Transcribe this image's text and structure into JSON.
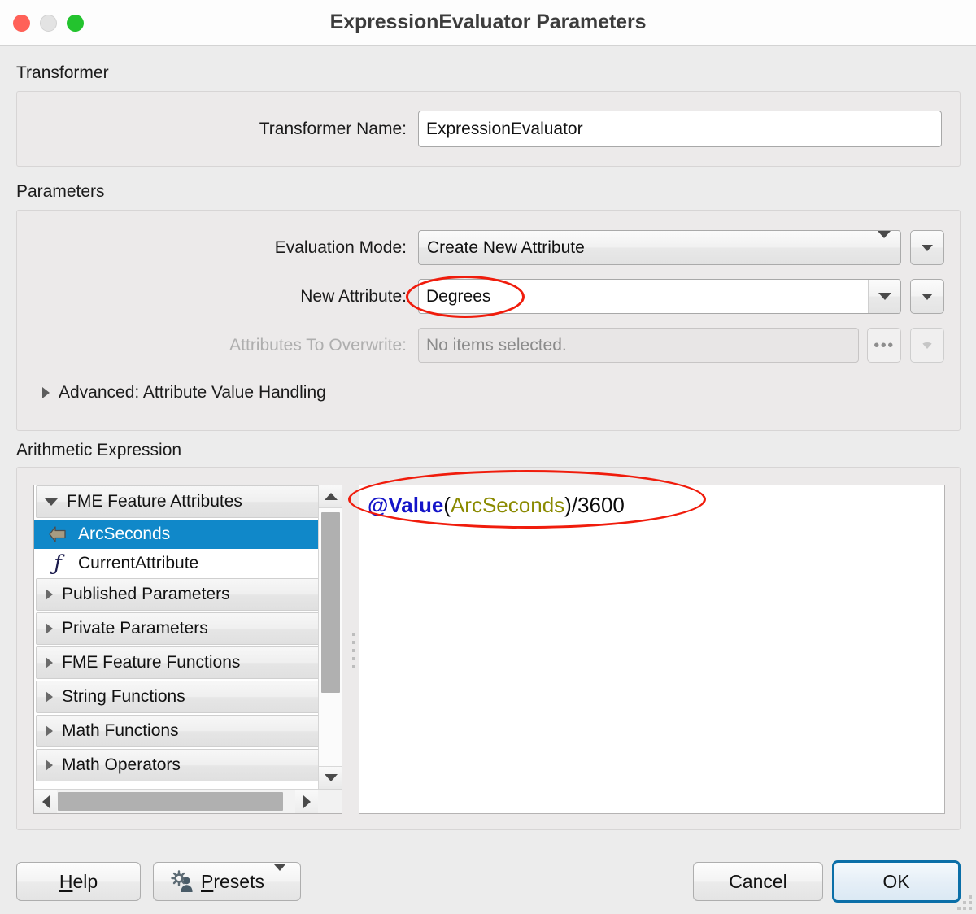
{
  "window": {
    "title": "ExpressionEvaluator Parameters",
    "traffic_lights": [
      "close-button",
      "minimize-button",
      "zoom-button"
    ]
  },
  "transformer_section": {
    "label": "Transformer",
    "name_label": "Transformer Name:",
    "name_value": "ExpressionEvaluator"
  },
  "parameters_section": {
    "label": "Parameters",
    "evaluation_mode": {
      "label": "Evaluation Mode:",
      "value": "Create New Attribute"
    },
    "new_attribute": {
      "label": "New Attribute:",
      "value": "Degrees"
    },
    "attributes_to_overwrite": {
      "label": "Attributes To Overwrite:",
      "value": "No items selected.",
      "browse_label": "...",
      "disabled": true
    },
    "advanced": {
      "label": "Advanced: Attribute Value Handling",
      "expanded": false
    }
  },
  "expression_section": {
    "label": "Arithmetic Expression",
    "tree": [
      {
        "label": "FME Feature Attributes",
        "type": "group",
        "expanded": true,
        "icon": "chevron-down-icon"
      },
      {
        "label": "ArcSeconds",
        "type": "leaf",
        "selected": true,
        "icon": "attribute-arrow-icon"
      },
      {
        "label": "CurrentAttribute",
        "type": "leaf",
        "selected": false,
        "icon": "function-fx-icon"
      },
      {
        "label": "Published Parameters",
        "type": "group",
        "expanded": false,
        "icon": "chevron-right-icon"
      },
      {
        "label": "Private Parameters",
        "type": "group",
        "expanded": false,
        "icon": "chevron-right-icon"
      },
      {
        "label": "FME Feature Functions",
        "type": "group",
        "expanded": false,
        "icon": "chevron-right-icon"
      },
      {
        "label": "String Functions",
        "type": "group",
        "expanded": false,
        "icon": "chevron-right-icon"
      },
      {
        "label": "Math Functions",
        "type": "group",
        "expanded": false,
        "icon": "chevron-right-icon"
      },
      {
        "label": "Math Operators",
        "type": "group",
        "expanded": false,
        "icon": "chevron-right-icon"
      }
    ],
    "editor": {
      "full_text": "@Value(ArcSeconds)/3600",
      "tokens": [
        {
          "text": "@Value",
          "kind": "function",
          "color": "#1414c8"
        },
        {
          "text": "(",
          "kind": "plain",
          "color": "#0a0a0a"
        },
        {
          "text": "ArcSeconds",
          "kind": "attribute",
          "color": "#8a8a00"
        },
        {
          "text": ")/3600",
          "kind": "plain",
          "color": "#0a0a0a"
        }
      ]
    }
  },
  "footer": {
    "help_label": "Help",
    "presets_label": "Presets",
    "cancel_label": "Cancel",
    "ok_label": "OK"
  },
  "annotations": {
    "color": "#f01c0c",
    "highlighted": [
      "new-attribute-value",
      "expression-editor-text"
    ]
  }
}
